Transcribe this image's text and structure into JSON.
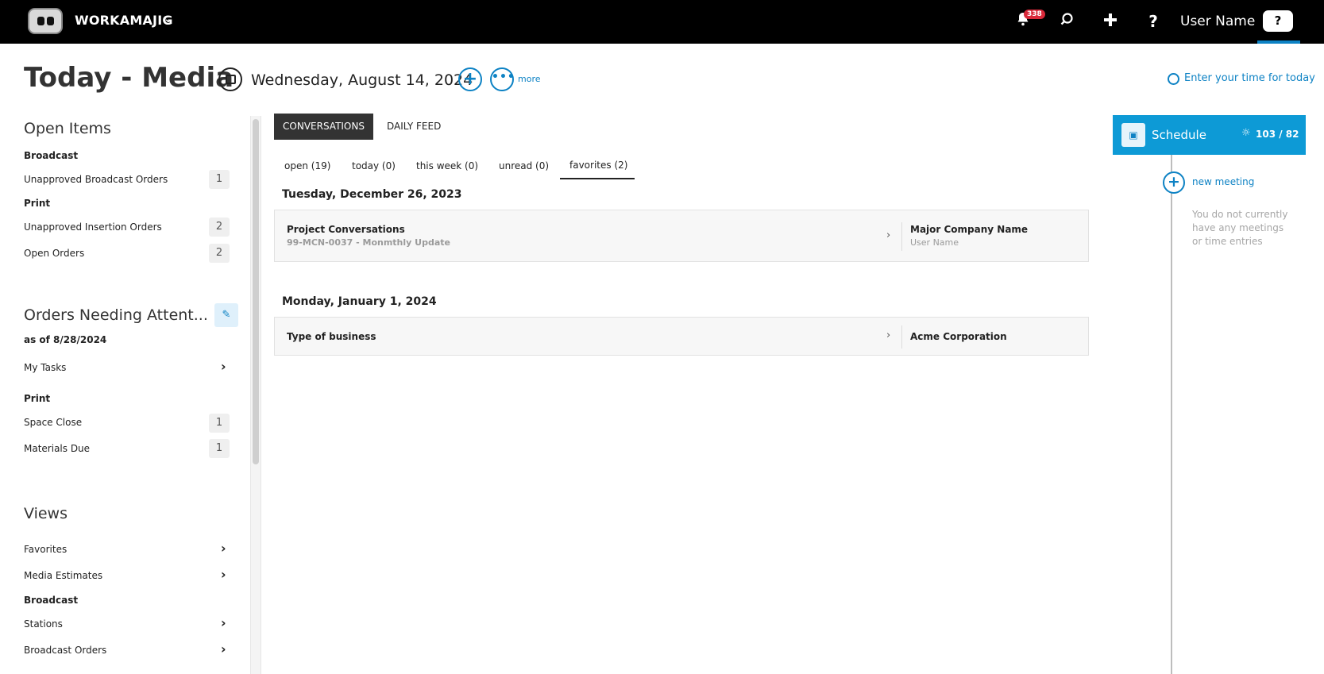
{
  "topbar": {
    "brand": "WORKAMAJIG",
    "brand_chevron": "⌄",
    "notifications_count": "338",
    "username": "User Name",
    "icons": [
      "bell-icon",
      "search-icon",
      "plus-icon",
      "help-icon",
      "help-box-icon"
    ]
  },
  "header": {
    "title": "Today - Media",
    "date": "Wednesday, August 14, 2024",
    "more_label": "more",
    "enter_time_label": "Enter your time for today"
  },
  "left": {
    "open_items": {
      "title": "Open Items",
      "groups": [
        {
          "name": "Broadcast",
          "items": [
            {
              "label": "Unapproved Broadcast Orders",
              "count": "1"
            }
          ]
        },
        {
          "name": "Print",
          "items": [
            {
              "label": "Unapproved Insertion Orders",
              "count": "2"
            },
            {
              "label": "Open Orders",
              "count": "2"
            }
          ]
        }
      ]
    },
    "orders_attention": {
      "title": "Orders Needing Attent...",
      "as_of": "as of 8/28/2024",
      "my_tasks": "My Tasks",
      "group": "Print",
      "items": [
        {
          "label": "Space Close",
          "count": "1"
        },
        {
          "label": "Materials Due",
          "count": "1"
        }
      ]
    },
    "views": {
      "title": "Views",
      "items": [
        "Favorites",
        "Media Estimates"
      ],
      "group": "Broadcast",
      "group_items": [
        "Stations",
        "Broadcast Orders"
      ]
    }
  },
  "center": {
    "tabs": [
      "CONVERSATIONS",
      "DAILY FEED"
    ],
    "filters": [
      "open (19)",
      "today (0)",
      "this week (0)",
      "unread (0)",
      "favorites (2)"
    ],
    "sections": [
      {
        "date": "Tuesday, December 26, 2023",
        "title": "Project Conversations",
        "subtitle": "99-MCN-0037 - Monmthly Update",
        "company": "Major Company Name",
        "user": "User Name"
      },
      {
        "date": "Monday, January 1, 2024",
        "title": "Type of business",
        "company": "Acme Corporation"
      }
    ]
  },
  "right": {
    "schedule_label": "Schedule",
    "schedule_count": "103 / 82",
    "new_meeting": "new meeting",
    "no_meetings": "You do not currently have any meetings or time entries"
  },
  "colors": {
    "accent": "#0d82c4",
    "schedule_bg": "#0d9ad6",
    "badge": "#d9293a",
    "topbar": "#000000"
  }
}
